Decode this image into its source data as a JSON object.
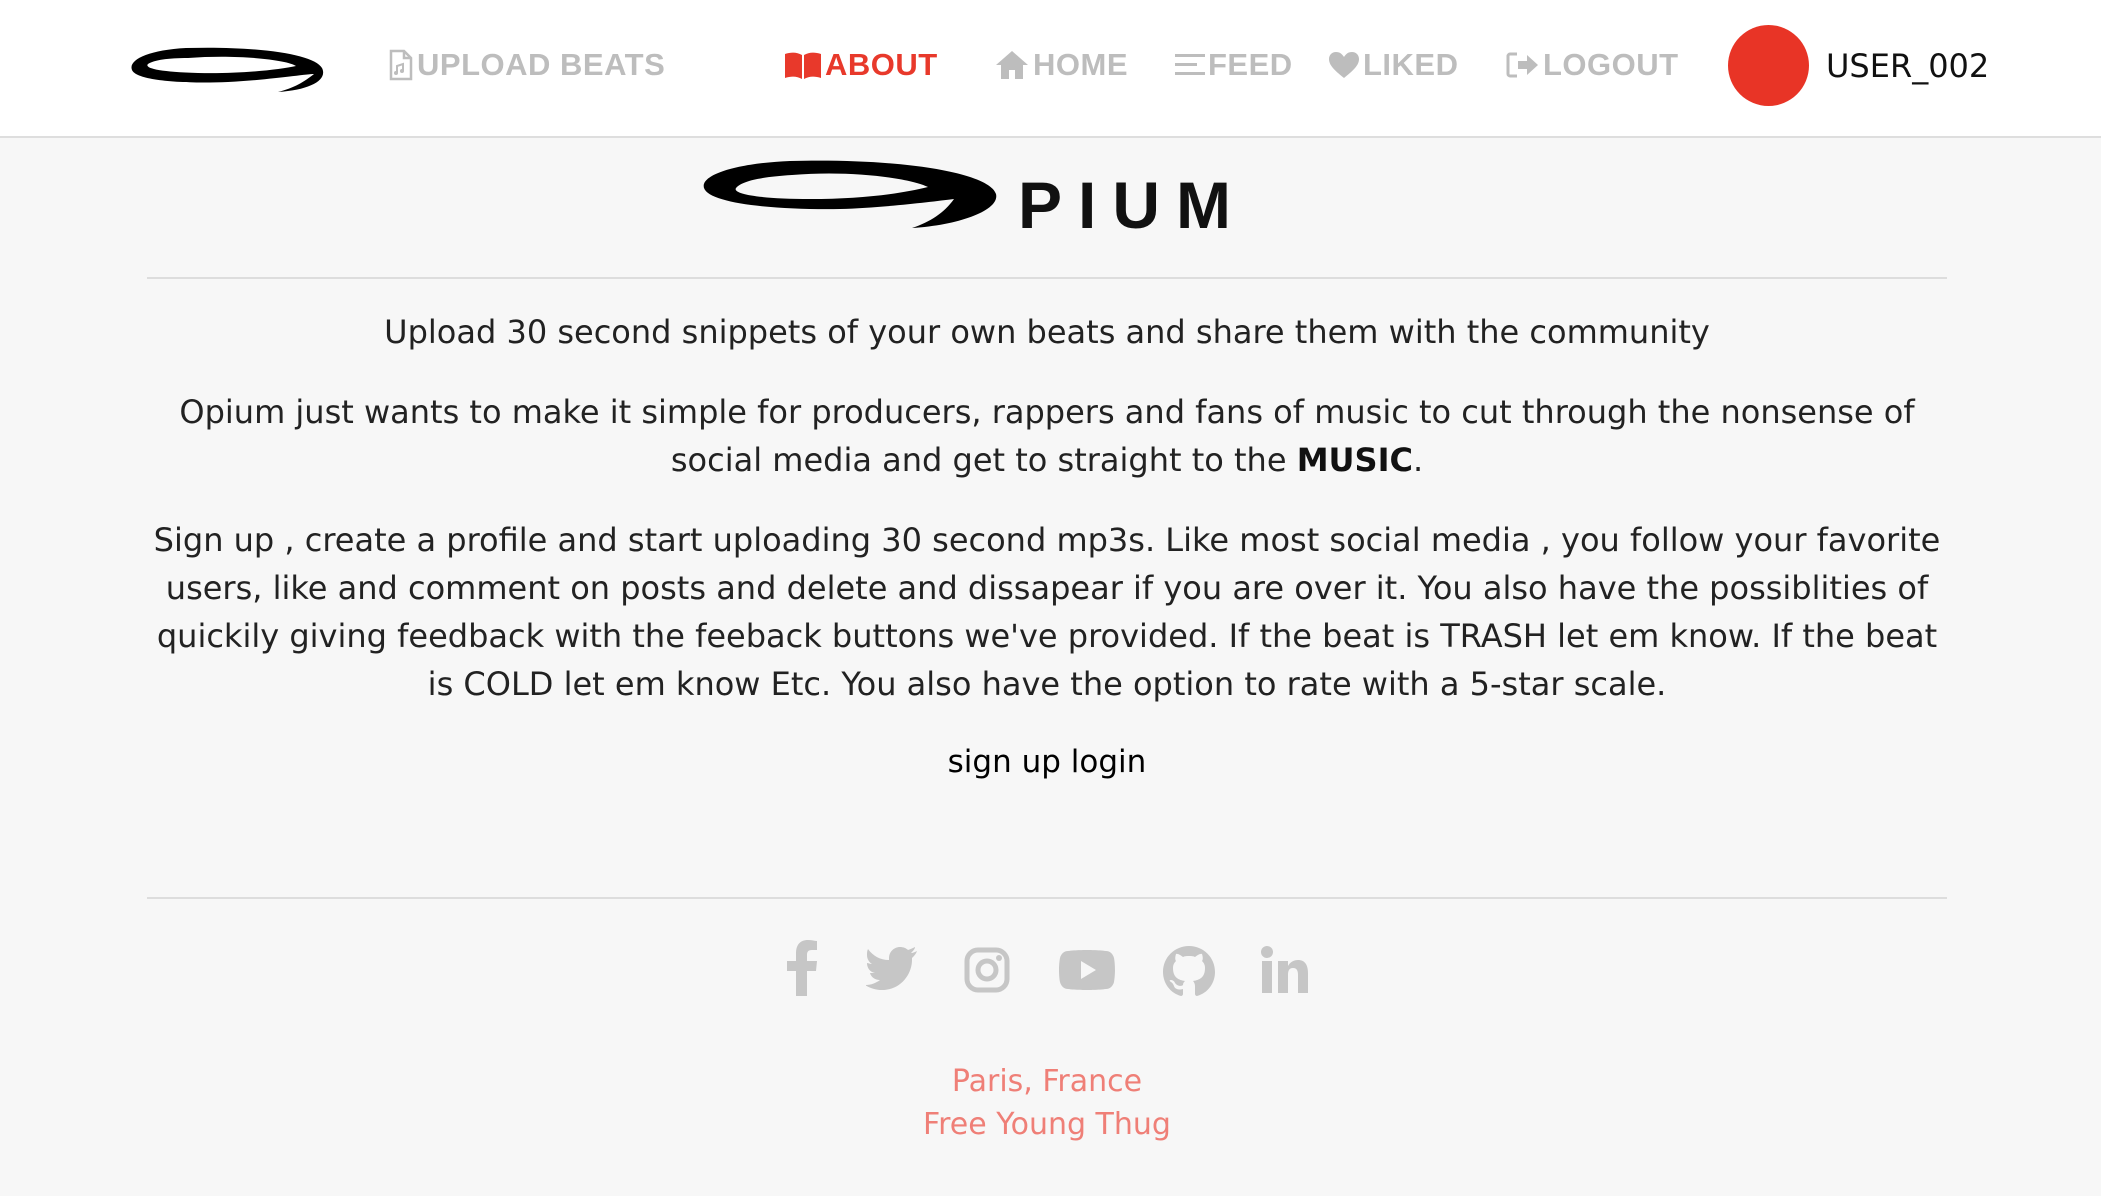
{
  "nav": {
    "items": [
      {
        "label": "UPLOAD BEATS",
        "icon": "file-audio-icon"
      },
      {
        "label": "ABOUT",
        "icon": "book-open-icon",
        "active": true
      },
      {
        "label": "HOME",
        "icon": "home-icon"
      },
      {
        "label": "FEED",
        "icon": "list-icon"
      },
      {
        "label": "LIKED",
        "icon": "heart-icon"
      },
      {
        "label": "LOGOUT",
        "icon": "sign-out-icon"
      }
    ],
    "username": "USER_002",
    "avatar_color": "#e83426"
  },
  "brand": {
    "name": "PIUM"
  },
  "about": {
    "intro": "Upload 30 second snippets of your own beats and share them with the community",
    "mission_before": "Opium just wants to make it simple for producers, rappers and fans of music to cut through the nonsense of social media and get to straight to the ",
    "mission_emphasis": "MUSIC",
    "mission_after": ".",
    "details": "Sign up , create a profile and start uploading 30 second mp3s. Like most social media , you follow your favorite users, like and comment on posts and delete and dissapear if you are over it. You also have the possiblities of quickily giving feedback with the feeback buttons we've provided. If the beat is TRASH let em know. If the beat is COLD let em know Etc. You also have the option to rate with a 5-star scale."
  },
  "auth": {
    "signup_label": "sign up",
    "login_label": "login"
  },
  "socials": [
    "facebook-icon",
    "twitter-icon",
    "instagram-icon",
    "youtube-icon",
    "github-icon",
    "linkedin-icon"
  ],
  "footer": {
    "location": "Paris, France",
    "tagline": "Free Young Thug"
  },
  "colors": {
    "accent": "#e8392b",
    "nav_inactive": "#bdbdbd",
    "footer_text": "#ef7f77",
    "social_icon": "#c6c6c6"
  }
}
